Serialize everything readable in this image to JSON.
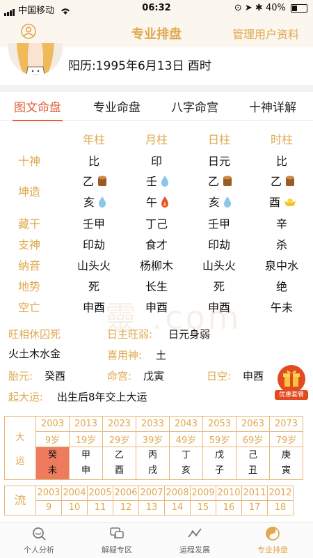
{
  "status": {
    "carrier": "中国移动",
    "time": "06:32",
    "battery": "40%",
    "battery_level": 0.4
  },
  "nav": {
    "title": "专业排盘",
    "right": "管理用户资料"
  },
  "profile": {
    "solar": "阳历:1995年6月13日 酉时"
  },
  "tabs": [
    "图文命盘",
    "专业命盘",
    "八字命宫",
    "十神详解"
  ],
  "columns": [
    "年柱",
    "月柱",
    "日柱",
    "时柱"
  ],
  "rows": {
    "shishen": {
      "label": "十神",
      "values": [
        "比",
        "印",
        "日元",
        "比"
      ]
    },
    "kunzao": {
      "label": "坤造",
      "gan": [
        {
          "c": "乙",
          "icon": "wood-icon"
        },
        {
          "c": "壬",
          "icon": "water-icon"
        },
        {
          "c": "乙",
          "icon": "wood-icon"
        },
        {
          "c": "乙",
          "icon": "wood-icon"
        }
      ],
      "zhi": [
        {
          "c": "亥",
          "icon": "water-icon"
        },
        {
          "c": "午",
          "icon": "fire-icon"
        },
        {
          "c": "亥",
          "icon": "water-icon"
        },
        {
          "c": "酉",
          "icon": "gold-icon"
        }
      ]
    },
    "canggan": {
      "label": "藏干",
      "values": [
        "壬甲",
        "丁己",
        "壬甲",
        "辛"
      ]
    },
    "zhishen": {
      "label": "支神",
      "values": [
        "印劫",
        "食才",
        "印劫",
        "杀"
      ]
    },
    "nayin": {
      "label": "纳音",
      "values": [
        "山头火",
        "杨柳木",
        "山头火",
        "泉中水"
      ]
    },
    "dishi": {
      "label": "地势",
      "values": [
        "死",
        "长生",
        "死",
        "绝"
      ]
    },
    "kongwang": {
      "label": "空亡",
      "values": [
        "申酉",
        "申酉",
        "申酉",
        "午未"
      ]
    }
  },
  "info": {
    "wangxiang_label": "旺相休囚死",
    "wangxiang_value": "火土木水金",
    "rizhu_label": "日主旺弱:",
    "rizhu_value": "日元身弱",
    "xiyong_label": "喜用神:",
    "xiyong_value": "土",
    "taiyuan_label": "胎元:",
    "taiyuan_value": "癸酉",
    "minggong_label": "命宫:",
    "minggong_value": "戊寅",
    "rikong_label": "日空:",
    "rikong_value": "申酉",
    "qiyun_label": "起大运:",
    "qiyun_value": "出生后8年交上大运",
    "gift_label": "优惠套餐"
  },
  "dayun": {
    "label": [
      "大",
      "运"
    ],
    "years": [
      "2003",
      "2013",
      "2023",
      "2033",
      "2043",
      "2053",
      "2063",
      "2073"
    ],
    "ages": [
      "9岁",
      "19岁",
      "29岁",
      "39岁",
      "49岁",
      "59岁",
      "69岁",
      "79岁"
    ],
    "ganzhi": [
      [
        "癸",
        "未"
      ],
      [
        "甲",
        "申"
      ],
      [
        "乙",
        "酉"
      ],
      [
        "丙",
        "戌"
      ],
      [
        "丁",
        "亥"
      ],
      [
        "戊",
        "子"
      ],
      [
        "己",
        "丑"
      ],
      [
        "庚",
        "寅"
      ]
    ]
  },
  "liunian": {
    "label": "流",
    "years": [
      "2003",
      "2004",
      "2005",
      "2006",
      "2007",
      "2008",
      "2009",
      "2010",
      "2011",
      "2012"
    ],
    "ages": [
      "9",
      "10",
      "11",
      "12",
      "13",
      "14",
      "15",
      "16",
      "17",
      "18"
    ]
  },
  "bottom": [
    "个人分析",
    "解疑专区",
    "运程发展",
    "专业排盘"
  ]
}
